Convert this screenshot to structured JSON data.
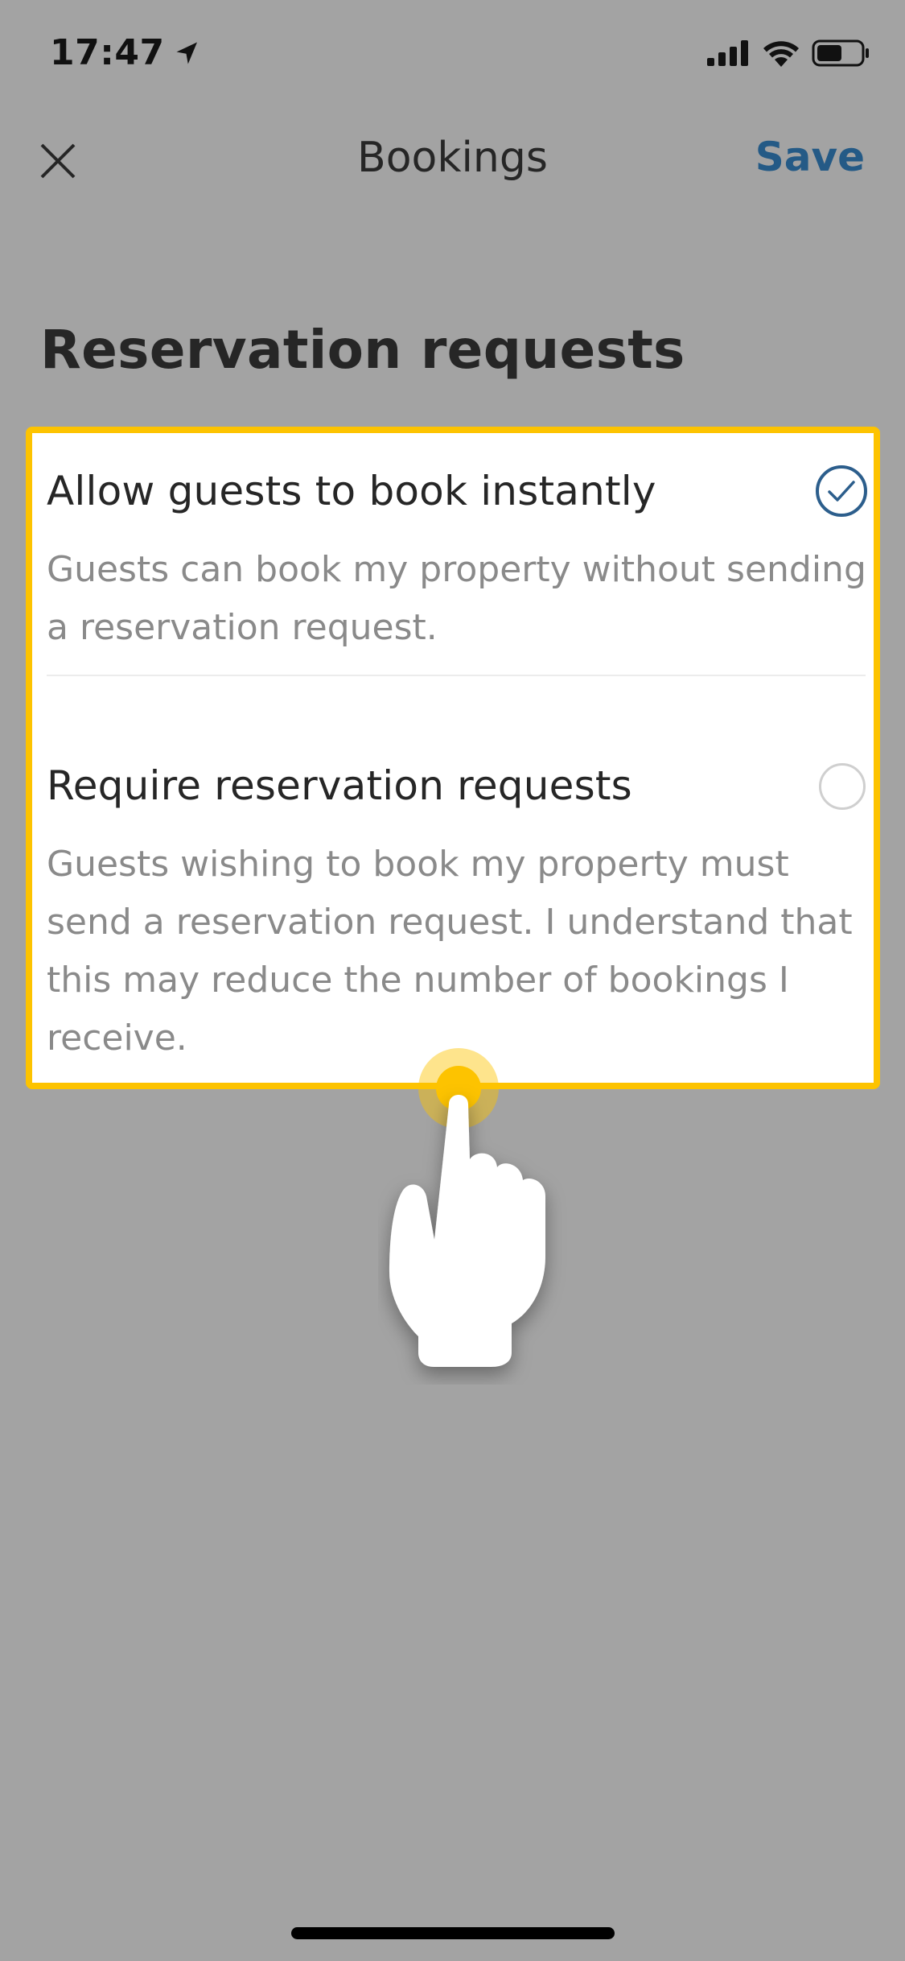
{
  "status_bar": {
    "time": "17:47"
  },
  "nav": {
    "title": "Bookings",
    "save_label": "Save"
  },
  "page": {
    "title": "Reservation requests"
  },
  "options": [
    {
      "title": "Allow guests to book instantly",
      "description": "Guests can book my property without sending a reservation request.",
      "selected": true
    },
    {
      "title": "Require reservation requests",
      "description": "Guests wishing to book my property must send a reservation request. I understand that this may reduce the number of bookings I receive.",
      "selected": false
    }
  ],
  "colors": {
    "background": "#a3a3a3",
    "accent": "#245a86",
    "highlight": "#fdc300"
  },
  "icons": {
    "close": "close-icon",
    "location": "location-arrow-icon",
    "signal": "signal-icon",
    "wifi": "wifi-icon",
    "battery": "battery-icon",
    "check": "check-icon",
    "tap_hand": "tap-hand-icon"
  }
}
